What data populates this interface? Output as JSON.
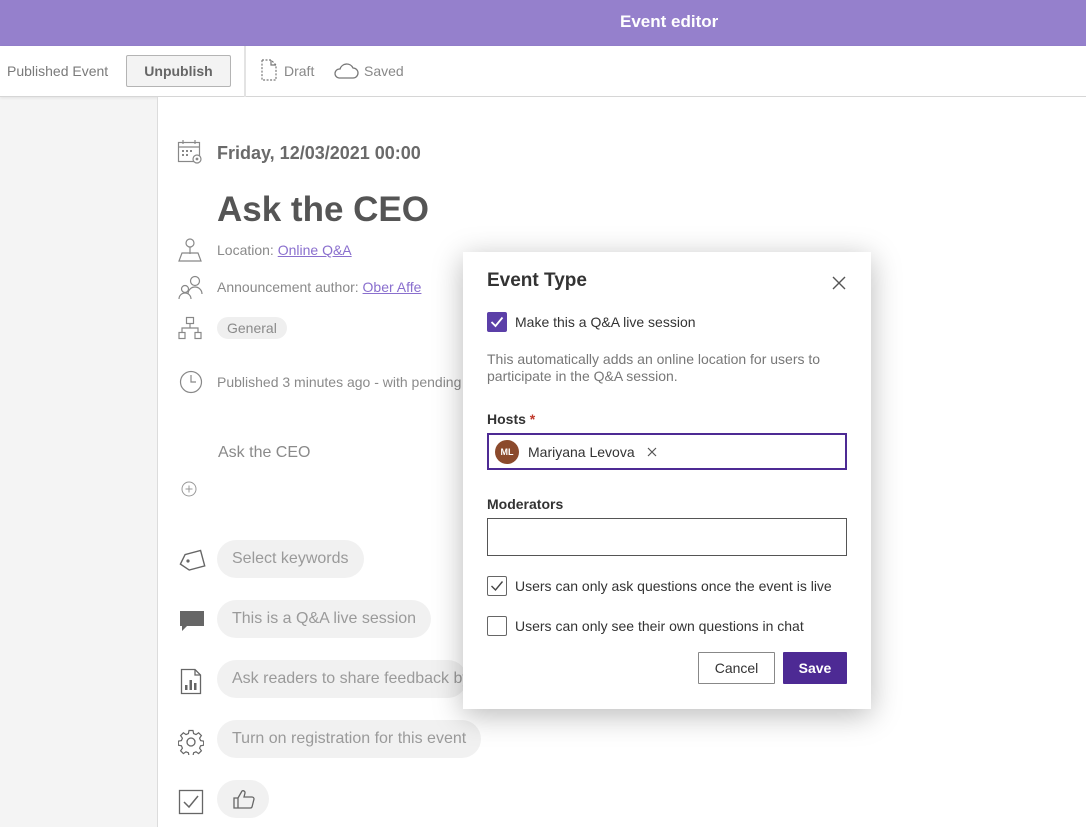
{
  "header": {
    "title": "Event editor"
  },
  "toolbar": {
    "status": "Published Event",
    "unpublish_label": "Unpublish",
    "draft_label": "Draft",
    "saved_label": "Saved"
  },
  "event": {
    "date": "Friday, 12/03/2021 00:00",
    "title": "Ask the CEO",
    "location_prefix": "Location:",
    "location_link": "Online Q&A",
    "author_prefix": "Announcement author:",
    "author_link": "Ober Affe",
    "category": "General",
    "published_text": "Published 3 minutes ago - with pending",
    "body_text": "Ask the CEO",
    "keywords_placeholder": "Select keywords",
    "qa_pill": "This is a Q&A live session",
    "feedback_pill": "Ask readers to share feedback by",
    "registration_pill": "Turn on registration for this event"
  },
  "dialog": {
    "title": "Event Type",
    "qa_checkbox_label": "Make this a Q&A live session",
    "qa_checked": true,
    "description": "This automatically adds an online location for users to participate in the Q&A session.",
    "hosts_label": "Hosts",
    "required_mark": "*",
    "hosts": [
      {
        "initials": "ML",
        "name": "Mariyana Levova"
      }
    ],
    "moderators_label": "Moderators",
    "moderators_value": "",
    "live_only_label": "Users can only ask questions once the event is live",
    "live_only_checked": true,
    "own_questions_label": "Users can only see their own questions in chat",
    "own_questions_checked": false,
    "cancel_label": "Cancel",
    "save_label": "Save"
  },
  "colors": {
    "header": "#9580cc",
    "primary": "#4d2a94",
    "checkbox_filled": "#5b3fa8",
    "link": "#8a6fce",
    "avatar": "#8b4a2c"
  }
}
